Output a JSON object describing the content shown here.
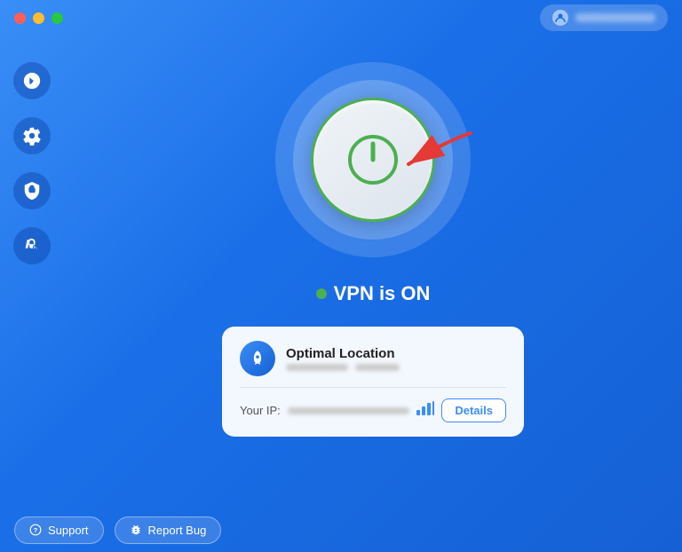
{
  "titleBar": {
    "trafficLights": [
      "red",
      "yellow",
      "green"
    ],
    "userBadge": {
      "label": "user@email.com"
    }
  },
  "sidebar": {
    "items": [
      {
        "id": "rocket",
        "icon": "🚀",
        "label": "Quick Connect"
      },
      {
        "id": "settings",
        "icon": "⚙️",
        "label": "Settings"
      },
      {
        "id": "lock",
        "icon": "🔒",
        "label": "Security"
      },
      {
        "id": "hand",
        "icon": "✋",
        "label": "Block"
      }
    ]
  },
  "vpnStatus": {
    "text": "VPN is ON",
    "dotColor": "#4CAF50"
  },
  "locationCard": {
    "title": "Optimal Location",
    "ipLabel": "Your IP:",
    "detailsButtonLabel": "Details"
  },
  "bottomBar": {
    "supportLabel": "Support",
    "reportBugLabel": "Report Bug"
  }
}
